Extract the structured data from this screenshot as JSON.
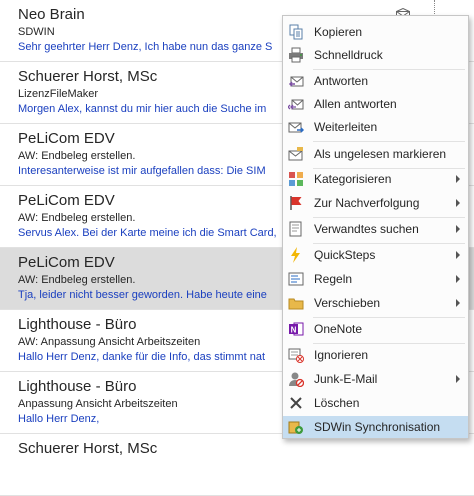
{
  "emails": [
    {
      "sender": "Neo Brain",
      "subject": "SDWIN",
      "preview": "Sehr geehrter Herr Denz,  Ich habe nun das ganze S"
    },
    {
      "sender": "Schuerer Horst, MSc",
      "subject": "LizenzFileMaker",
      "preview": "Morgen Alex,  kannst du mir hier auch die Suche im"
    },
    {
      "sender": "PeLiCom EDV",
      "subject": "AW: Endbeleg erstellen.",
      "preview": "Interesanterweise ist mir aufgefallen dass:  Die SIM"
    },
    {
      "sender": "PeLiCom EDV",
      "subject": "AW: Endbeleg erstellen.",
      "preview": "Servus Alex.  Bei der Karte meine ich die Smart Card,"
    },
    {
      "sender": "PeLiCom EDV",
      "subject": "AW: Endbeleg erstellen.",
      "preview": "Tja, leider nicht besser geworden.  Habe heute eine"
    },
    {
      "sender": "Lighthouse - Büro",
      "subject": "AW: Anpassung Ansicht Arbeitszeiten",
      "preview": "Hallo Herr Denz,  danke für die Info, das stimmt nat"
    },
    {
      "sender": "Lighthouse - Büro",
      "subject": "Anpassung Ansicht Arbeitszeiten",
      "preview": "Hallo Herr Denz,"
    },
    {
      "sender": "Schuerer Horst, MSc",
      "subject": "",
      "preview": ""
    }
  ],
  "menu": {
    "items": [
      {
        "label": "Kopieren",
        "icon": "copy-icon"
      },
      {
        "label": "Schnelldruck",
        "icon": "print-icon"
      },
      {
        "label": "Antworten",
        "icon": "reply-icon"
      },
      {
        "label": "Allen antworten",
        "icon": "reply-all-icon"
      },
      {
        "label": "Weiterleiten",
        "icon": "forward-icon"
      },
      {
        "label": "Als ungelesen markieren",
        "icon": "mark-unread-icon"
      },
      {
        "label": "Kategorisieren",
        "icon": "categorize-icon"
      },
      {
        "label": "Zur Nachverfolgung",
        "icon": "flag-icon"
      },
      {
        "label": "Verwandtes suchen",
        "icon": "find-related-icon"
      },
      {
        "label": "QuickSteps",
        "icon": "quicksteps-icon"
      },
      {
        "label": "Regeln",
        "icon": "rules-icon"
      },
      {
        "label": "Verschieben",
        "icon": "move-folder-icon"
      },
      {
        "label": "OneNote",
        "icon": "onenote-icon"
      },
      {
        "label": "Ignorieren",
        "icon": "ignore-icon"
      },
      {
        "label": "Junk-E-Mail",
        "icon": "junk-icon"
      },
      {
        "label": "Löschen",
        "icon": "delete-icon"
      },
      {
        "label": "SDWin Synchronisation",
        "icon": "sdwin-sync-icon"
      }
    ]
  },
  "colors": {
    "accent": "#2b579a",
    "preview_text": "#1a3fbf",
    "selected_row": "#dcdcdc",
    "highlight_item": "#c5ddf1"
  }
}
